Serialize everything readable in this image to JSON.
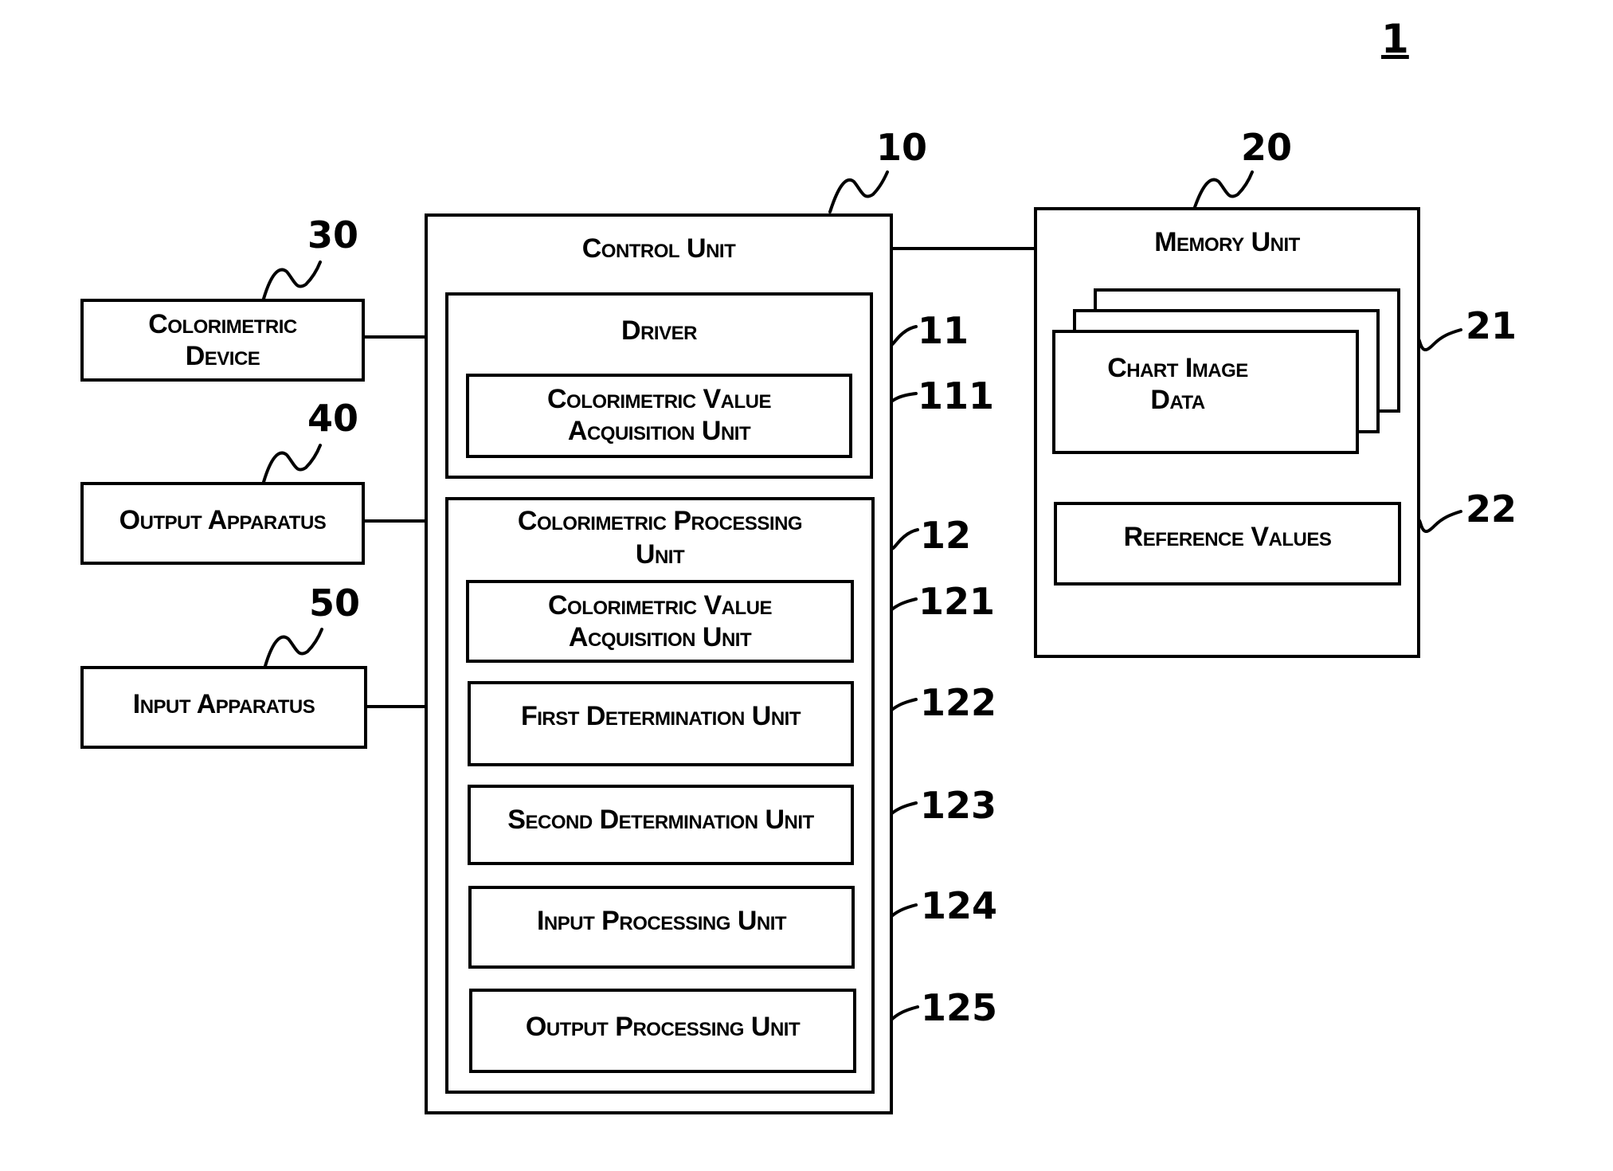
{
  "figure": {
    "sheet_ref": "1",
    "control_unit": {
      "ref": "10",
      "title": "Control Unit",
      "driver": {
        "ref": "11",
        "title": "Driver",
        "children": [
          {
            "ref": "111",
            "label_line1": "Colorimetric Value",
            "label_line2": "Acquisition Unit"
          }
        ]
      },
      "processing_unit": {
        "ref": "12",
        "title_line1": "Colorimetric Processing",
        "title_line2": "Unit",
        "children": [
          {
            "ref": "121",
            "label_line1": "Colorimetric Value",
            "label_line2": "Acquisition Unit"
          },
          {
            "ref": "122",
            "label": "First Determination Unit"
          },
          {
            "ref": "123",
            "label": "Second Determination Unit"
          },
          {
            "ref": "124",
            "label": "Input Processing Unit"
          },
          {
            "ref": "125",
            "label": "Output Processing Unit"
          }
        ]
      }
    },
    "memory_unit": {
      "ref": "20",
      "title": "Memory Unit",
      "chart_image_data": {
        "ref": "21",
        "label_line1": "Chart Image",
        "label_line2": "Data"
      },
      "reference_values": {
        "ref": "22",
        "label": "Reference Values"
      }
    },
    "peripherals": [
      {
        "ref": "30",
        "label_line1": "Colorimetric",
        "label_line2": "Device"
      },
      {
        "ref": "40",
        "label": "Output Apparatus"
      },
      {
        "ref": "50",
        "label": "Input Apparatus"
      }
    ]
  }
}
